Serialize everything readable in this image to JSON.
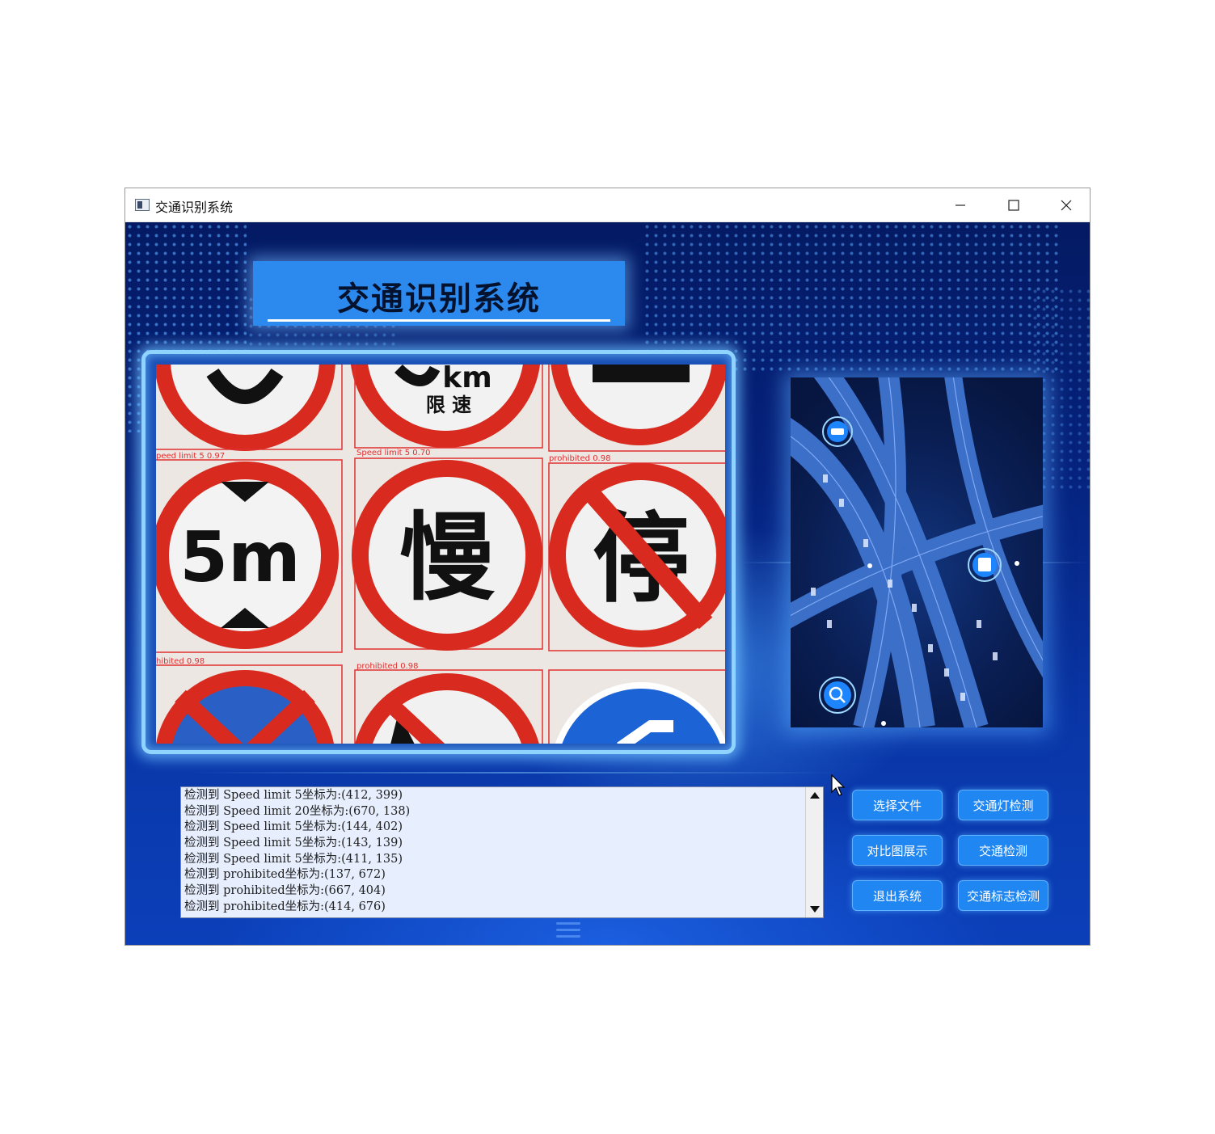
{
  "window": {
    "title": "交通识别系统"
  },
  "header": {
    "title": "交通识别系统"
  },
  "detection_image": {
    "labels": [
      "peed limit 5 0.97",
      "Speed limit 5 0.70",
      "prohibited 0.98",
      "hibited 0.98",
      "prohibited 0.98"
    ],
    "sign_texts": {
      "speed_unit": "限 速",
      "height_limit": "5m",
      "slow": "慢",
      "stop": "停"
    }
  },
  "log": {
    "lines": [
      "检测到 Speed limit 5坐标为:(412, 399)",
      "检测到 Speed limit 20坐标为:(670, 138)",
      "检测到 Speed limit 5坐标为:(144, 402)",
      "检测到 Speed limit 5坐标为:(143, 139)",
      "检测到 Speed limit 5坐标为:(411, 135)",
      "检测到 prohibited坐标为:(137, 672)",
      "检测到 prohibited坐标为:(667, 404)",
      "检测到 prohibited坐标为:(414, 676)"
    ]
  },
  "buttons": {
    "select_file": "选择文件",
    "traffic_light": "交通灯检测",
    "compare": "对比图展示",
    "traffic_detect": "交通检测",
    "exit": "退出系统",
    "sign_detect": "交通标志检测"
  },
  "colors": {
    "accent": "#1f86f2",
    "title_panel": "#2c8aef",
    "background": "#06237e",
    "box": "#e03030"
  }
}
